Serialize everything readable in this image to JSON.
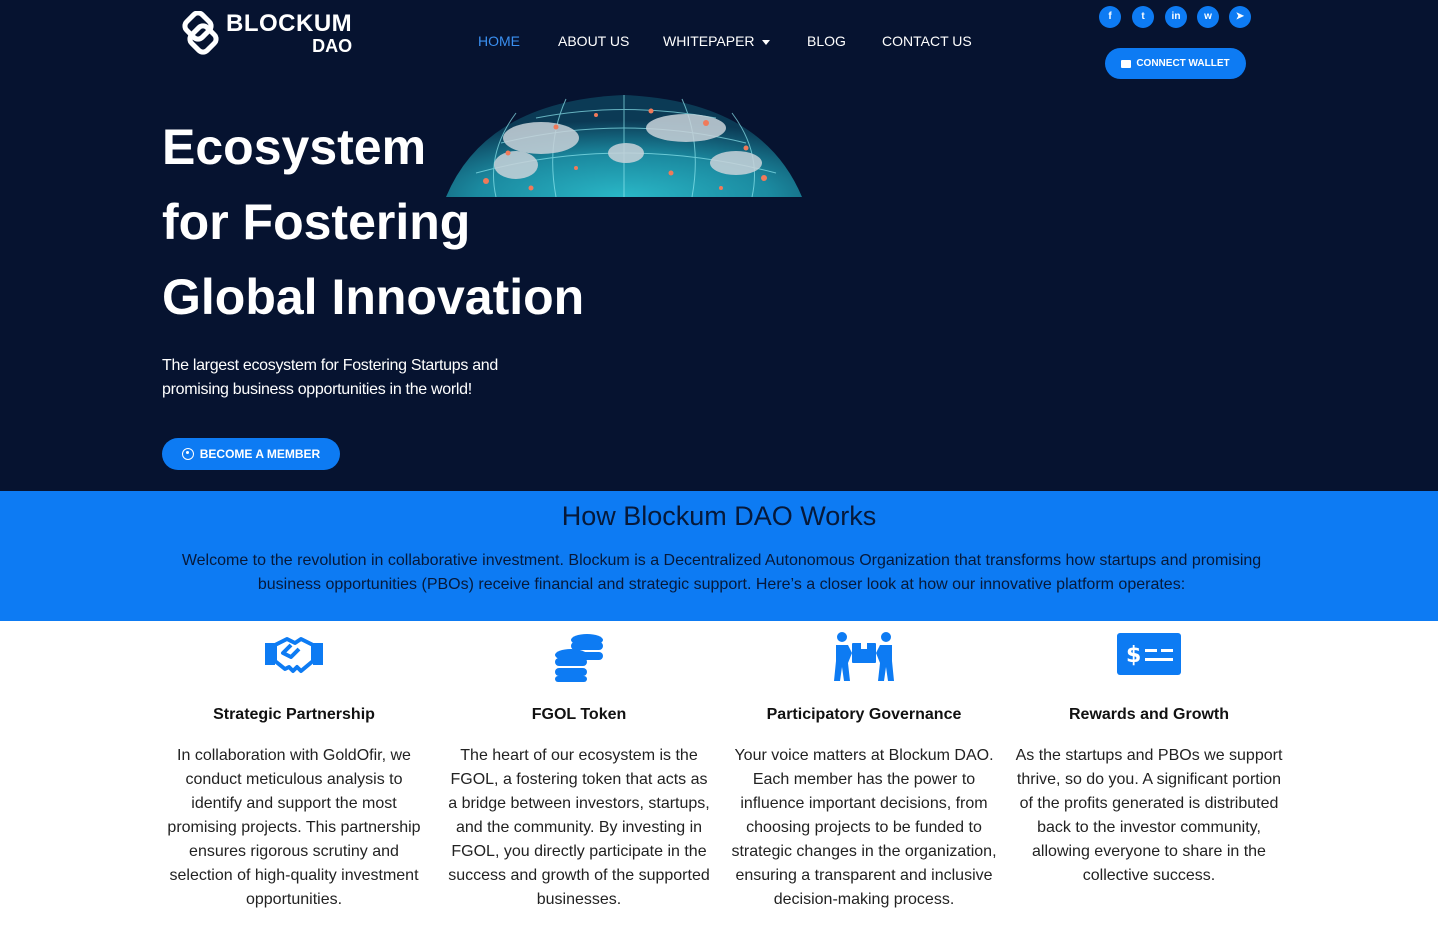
{
  "logo": {
    "line1": "BLOCKUM",
    "line2": "DAO"
  },
  "nav": {
    "home": "HOME",
    "about": "ABOUT US",
    "whitepaper": "WHITEPAPER",
    "blog": "BLOG",
    "contact": "CONTACT US"
  },
  "social": [
    {
      "icon": "facebook-icon",
      "glyph": "f"
    },
    {
      "icon": "twitter-icon",
      "glyph": "t"
    },
    {
      "icon": "linkedin-icon",
      "glyph": "in"
    },
    {
      "icon": "whatsapp-icon",
      "glyph": "w"
    },
    {
      "icon": "telegram-icon",
      "glyph": "➤"
    }
  ],
  "wallet": {
    "label": "CONNECT WALLET"
  },
  "hero": {
    "title_line1": "Ecosystem",
    "title_line2": "for Fostering",
    "title_line3": "Global Innovation",
    "subtitle": "The largest ecosystem for Fostering Startups and promising business opportunities in the world!",
    "cta": "BECOME A MEMBER"
  },
  "how": {
    "title": "How Blockum DAO Works",
    "text": "Welcome to the revolution in collaborative investment. Blockum is a Decentralized Autonomous Organization that transforms how startups and promising business opportunities (PBOs) receive financial and strategic support. Here’s a closer look at how our innovative platform operates:"
  },
  "features": [
    {
      "icon": "handshake-icon",
      "title": "Strategic Partnership",
      "text": "In collaboration with GoldOfir, we conduct meticulous analysis to identify and support the most promising projects. This partnership ensures rigorous scrutiny and selection of high-quality investment opportunities."
    },
    {
      "icon": "coins-icon",
      "title": "FGOL Token",
      "text": "The heart of our ecosystem is the FGOL, a fostering token that acts as a bridge between investors, startups, and the community. By investing in FGOL, you directly participate in the success and growth of the supported businesses."
    },
    {
      "icon": "people-carry-icon",
      "title": "Participatory Governance",
      "text": "Your voice matters at Blockum DAO. Each member has the power to influence important decisions, from choosing projects to be funded to strategic changes in the organization, ensuring a transparent and inclusive decision-making process."
    },
    {
      "icon": "money-check-icon",
      "title": "Rewards and Growth",
      "text": "As the startups and PBOs we support thrive, so do you. A significant portion of the profits generated is distributed back to the investor community, allowing everyone to share in the collective success."
    }
  ],
  "colors": {
    "navy": "#061330",
    "accent": "#0d7bf3",
    "active_link": "#3a8ff0"
  }
}
